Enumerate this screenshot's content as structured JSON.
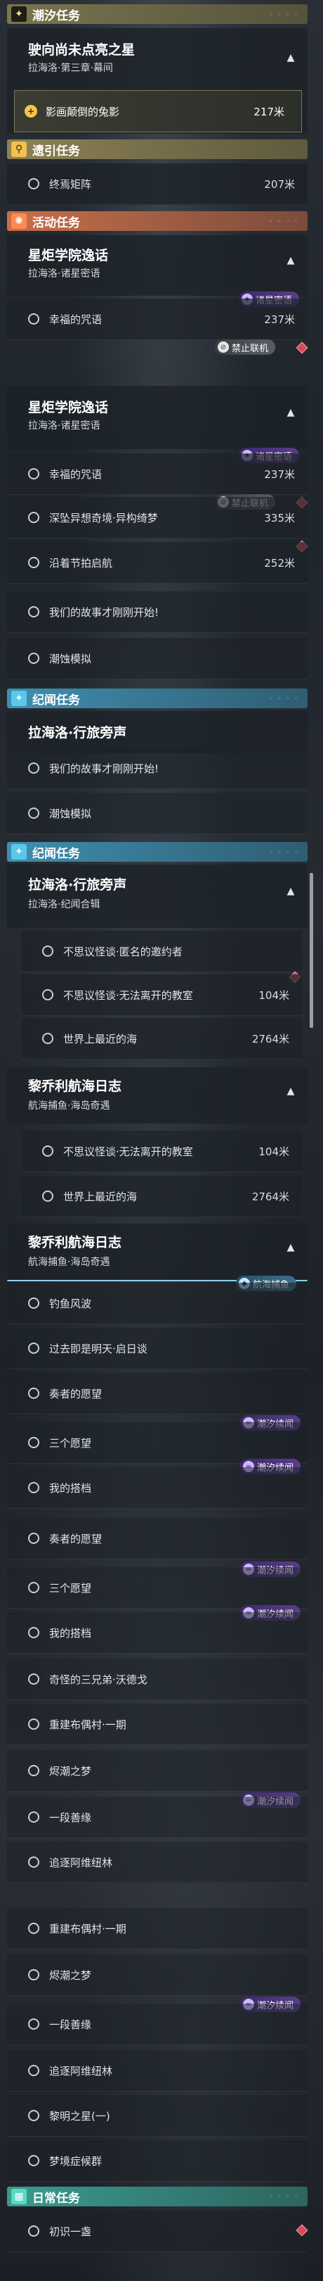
{
  "sections": {
    "tide": "潮汐任务",
    "guide": "遗引任务",
    "activity": "活动任务",
    "chronicle": "纪闻任务",
    "daily": "日常任务"
  },
  "tide_card": {
    "title": "驶向尚未点亮之星",
    "sub": "拉海洛·第三章·幕间",
    "active": "影画颠倒的兔影",
    "active_dist": "217米"
  },
  "guide_row": {
    "label": "终焉矩阵",
    "dist": "207米"
  },
  "act_card": {
    "title": "星炬学院逸话",
    "sub": "拉海洛·诸星密语"
  },
  "rows1": [
    {
      "label": "幸福的咒语",
      "dist": "237米"
    },
    {
      "label": "深坠异想奇境·异构绮梦",
      "dist": "335米"
    }
  ],
  "badges": {
    "star": "诸星密语",
    "coop": "禁止联机",
    "tidecont": "潮汐续闻",
    "fishing": "航海捕鱼"
  },
  "act_card2": {
    "title": "星炬学院逸话",
    "sub": "拉海洛·诸星密语"
  },
  "rows2": [
    {
      "label": "幸福的咒语",
      "dist": "237米"
    },
    {
      "label": "深坠异想奇境·异构绮梦",
      "dist": "335米"
    },
    {
      "label": "沿着节拍启航",
      "dist": "252米"
    },
    {
      "label": "我们的故事才刚刚开始!",
      "dist": ""
    },
    {
      "label": "潮蚀模拟",
      "dist": ""
    }
  ],
  "chron_card1": {
    "title": "拉海洛·行旅旁声"
  },
  "rows3": [
    {
      "label": "我们的故事才刚刚开始!"
    },
    {
      "label": "潮蚀模拟"
    }
  ],
  "chron_card2": {
    "title": "拉海洛·行旅旁声",
    "sub": "拉海洛·纪闻合辑"
  },
  "rows4": [
    {
      "label": "不思议怪谈·匿名的邀约者",
      "dist": ""
    },
    {
      "label": "不思议怪谈·无法离开的教室",
      "dist": "104米"
    },
    {
      "label": "世界上最近的海",
      "dist": "2764米"
    }
  ],
  "chron_card3": {
    "title": "黎乔利航海日志",
    "sub": "航海捕鱼·海岛奇遇"
  },
  "rows5": [
    {
      "label": "不思议怪谈·无法离开的教室",
      "dist": "104米"
    },
    {
      "label": "世界上最近的海",
      "dist": "2764米"
    }
  ],
  "chron_card4": {
    "title": "黎乔利航海日志",
    "sub": "航海捕鱼·海岛奇遇"
  },
  "rows6": [
    "钓鱼风波",
    "过去即是明天·启日谈",
    "奏者的愿望",
    "三个愿望",
    "我的搭档"
  ],
  "rows7": [
    "奏者的愿望",
    "三个愿望",
    "我的搭档",
    "奇怪的三兄弟·沃德戈",
    "重建布偶村·一期",
    "烬潮之梦",
    "一段善缘",
    "追逐阿维纽林"
  ],
  "rows8": [
    "重建布偶村·一期",
    "烬潮之梦",
    "一段善缘",
    "追逐阿维纽林",
    "黎明之星(一)",
    "梦境症候群"
  ],
  "daily_row": {
    "label": "初识一盏"
  }
}
